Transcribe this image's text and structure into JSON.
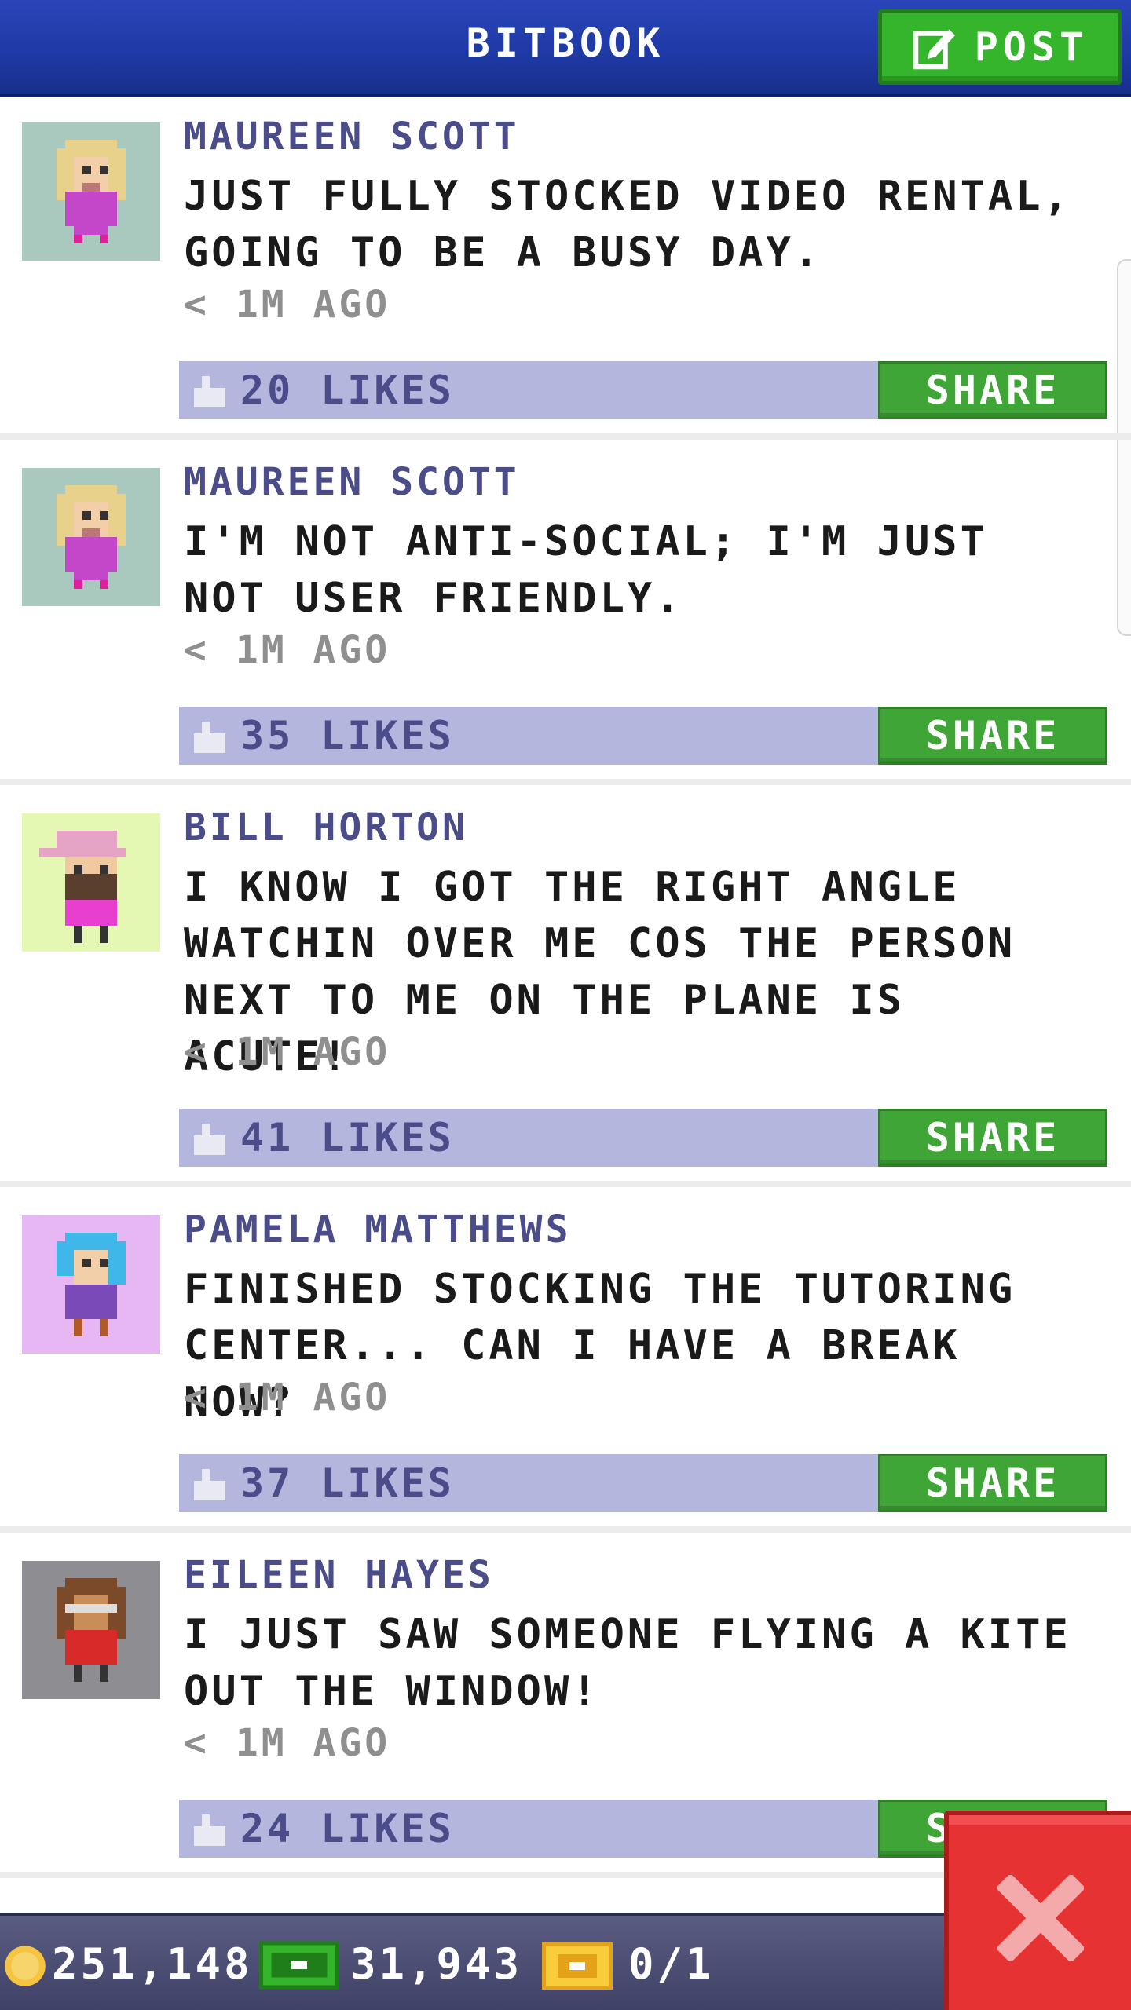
{
  "header": {
    "title": "BITBOOK",
    "post_label": "POST"
  },
  "posts": [
    {
      "author": "MAUREEN SCOTT",
      "text": "JUST FULLY STOCKED VIDEO RENTAL, GOING TO BE A BUSY DAY.",
      "time": "< 1M AGO",
      "likes": "20 LIKES",
      "share_label": "SHARE",
      "avatar_icon": "avatar-woman-blonde-pink",
      "avatar_bg": "#a9c9bf"
    },
    {
      "author": "MAUREEN SCOTT",
      "text": "I'M NOT ANTI-SOCIAL; I'M JUST NOT USER FRIENDLY.",
      "time": "< 1M AGO",
      "likes": "35 LIKES",
      "share_label": "SHARE",
      "avatar_icon": "avatar-woman-blonde-pink",
      "avatar_bg": "#a9c9bf"
    },
    {
      "author": "BILL HORTON",
      "text": "I KNOW I GOT THE RIGHT ANGLE WATCHIN OVER ME COS THE PERSON NEXT TO ME ON THE PLANE IS ACUTE!",
      "time": "< 1M AGO",
      "likes": "41 LIKES",
      "share_label": "SHARE",
      "avatar_icon": "avatar-man-cap-beard",
      "avatar_bg": "#e4f7b3"
    },
    {
      "author": "PAMELA MATTHEWS",
      "text": "FINISHED STOCKING THE TUTORING CENTER... CAN I HAVE A BREAK NOW?",
      "time": "< 1M AGO",
      "likes": "37 LIKES",
      "share_label": "SHARE",
      "avatar_icon": "avatar-woman-blue-hair",
      "avatar_bg": "#e7b7f3"
    },
    {
      "author": "EILEEN HAYES",
      "text": "I JUST SAW SOMEONE FLYING A KITE OUT THE WINDOW!",
      "time": "< 1M AGO",
      "likes": "24 LIKES",
      "share_label": "SHARE",
      "avatar_icon": "avatar-woman-glasses-red",
      "avatar_bg": "#8e8d91"
    }
  ],
  "status": {
    "coins": "251,148",
    "bux": "31,943",
    "tickets": "0/1"
  },
  "colors": {
    "header_blue": "#1f3aa6",
    "post_green": "#35b52b",
    "share_green": "#3fa537",
    "likes_bar": "#b4b6dd",
    "author_purple": "#4b4c8a",
    "close_red": "#e63232"
  }
}
